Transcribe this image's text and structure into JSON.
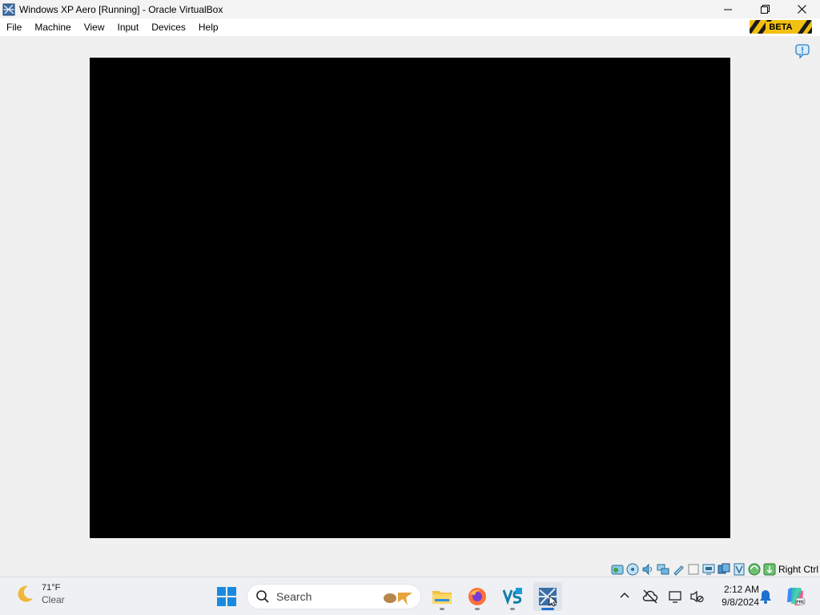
{
  "window": {
    "title": "Windows XP Aero [Running] - Oracle VirtualBox",
    "app_icon": "virtualbox-icon",
    "controls": [
      "minimize-icon",
      "restore-icon",
      "close-icon"
    ]
  },
  "menubar": {
    "items": [
      {
        "label": "File"
      },
      {
        "label": "Machine"
      },
      {
        "label": "View"
      },
      {
        "label": "Input"
      },
      {
        "label": "Devices"
      },
      {
        "label": "Help"
      }
    ],
    "beta_badge": "BETA"
  },
  "statusbar": {
    "icons": [
      "hard-disk-icon",
      "optical-drive-icon",
      "audio-icon",
      "network-icon",
      "usb-icon",
      "shared-folders-icon",
      "display-icon",
      "video-capture-icon",
      "guest-additions-icon",
      "mouse-integration-icon",
      "keyboard-icon"
    ],
    "host_key": "Right Ctrl"
  },
  "taskbar": {
    "weather": {
      "temperature": "71°F",
      "condition": "Clear",
      "icon": "moon-icon"
    },
    "search_placeholder": "Search",
    "apps": [
      "file-explorer-icon",
      "firefox-icon",
      "visual-studio-icon",
      "virtualbox-icon"
    ],
    "active_app": "virtualbox-icon",
    "tray": {
      "time": "2:12 AM",
      "date": "9/8/2024"
    }
  },
  "colors": {
    "vm_screen": "#000000",
    "workspace": "#f0f0f0",
    "accent": "#1f6fcf"
  }
}
